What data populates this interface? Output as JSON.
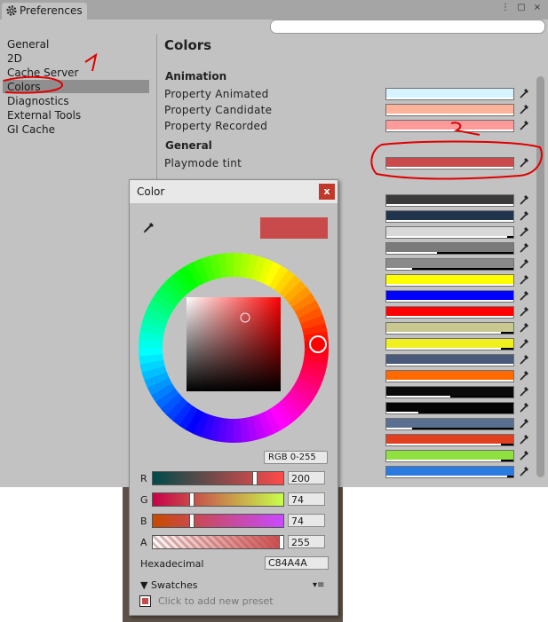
{
  "window": {
    "title": "Preferences",
    "controls": [
      "⋮",
      "▢",
      "×"
    ]
  },
  "sidebar": {
    "items": [
      {
        "label": "General"
      },
      {
        "label": "2D"
      },
      {
        "label": "Cache Server"
      },
      {
        "label": "Colors",
        "selected": true
      },
      {
        "label": "Diagnostics"
      },
      {
        "label": "External Tools"
      },
      {
        "label": "GI Cache"
      }
    ]
  },
  "content": {
    "title": "Colors",
    "animation_header": "Animation",
    "general_header": "General",
    "rows": [
      {
        "label": "Property Animated",
        "color": "#d6f3ff"
      },
      {
        "label": "Property Candidate",
        "color": "#ffb39a"
      },
      {
        "label": "Property Recorded",
        "color": "#ff9a9a"
      },
      {
        "label": "Playmode tint",
        "color": "#c84a4a"
      }
    ],
    "extra_swatches": [
      {
        "color": "#3a3a3a",
        "alpha": 1.0
      },
      {
        "color": "#20344e",
        "alpha": 1.0
      },
      {
        "color": "#d8d8d8",
        "alpha": 0.95
      },
      {
        "color": "#7a7a7a",
        "alpha": 0.4
      },
      {
        "color": "#8a8a8a",
        "alpha": 0.2
      },
      {
        "color": "#ffff00",
        "alpha": 1.0
      },
      {
        "color": "#0000ff",
        "alpha": 1.0
      },
      {
        "color": "#ff0000",
        "alpha": 1.0
      },
      {
        "color": "#c8c890",
        "alpha": 0.9
      },
      {
        "color": "#f0f020",
        "alpha": 0.9
      },
      {
        "color": "#4a5a7a",
        "alpha": 1.0
      },
      {
        "color": "#ff6a00",
        "alpha": 1.0
      },
      {
        "color": "#0a0a0a",
        "alpha": 0.5
      },
      {
        "color": "#050505",
        "alpha": 0.25
      },
      {
        "color": "#5a7090",
        "alpha": 0.2
      },
      {
        "color": "#e04020",
        "alpha": 0.9
      },
      {
        "color": "#90e040",
        "alpha": 0.9
      },
      {
        "color": "#2a7ae0",
        "alpha": 0.95
      }
    ]
  },
  "annotations": {
    "mark_1": "1",
    "mark_2": "2",
    "color": "#e00000"
  },
  "color_picker": {
    "title": "Color",
    "close": "x",
    "current_color": "#c84a4a",
    "mode": "RGB 0-255",
    "channels": [
      {
        "label": "R",
        "value": "200"
      },
      {
        "label": "G",
        "value": "74"
      },
      {
        "label": "B",
        "value": "74"
      },
      {
        "label": "A",
        "value": "255"
      }
    ],
    "hex_label": "Hexadecimal",
    "hex_value": "C84A4A",
    "swatches_label": "Swatches",
    "swatches_menu": "▾≡",
    "add_preset": "Click to add new preset"
  }
}
